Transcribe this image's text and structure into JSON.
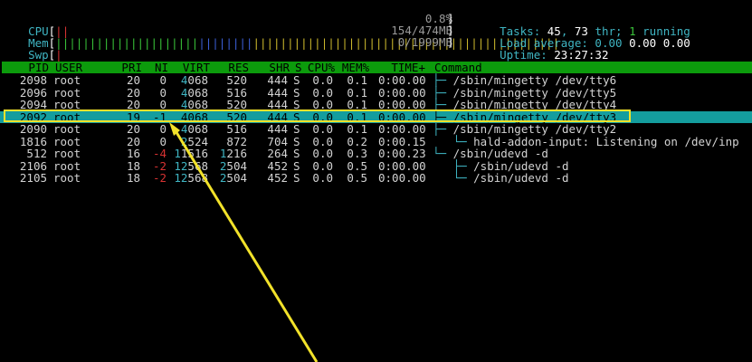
{
  "meters": {
    "cpu": {
      "label": "CPU",
      "bar": "||",
      "value": "0.8%"
    },
    "mem": {
      "label": "Mem",
      "bar_green": "|||||||||||||||||||||",
      "bar_blue": "||||||||",
      "bar_yellow": "|||||||||||||||||||||||||||||||||||||||||||||",
      "value": "154/474MB"
    },
    "swp": {
      "label": "Swp",
      "bar": "|",
      "value": "0/1999MB"
    }
  },
  "stats": {
    "tasks_label": "Tasks: ",
    "tasks": "45",
    "threads": "73",
    "thr_label": " thr; ",
    "running": "1",
    "running_label": " running",
    "load_label": "Load average: ",
    "load1": "0.00",
    "load5": "0.00",
    "load15": "0.00",
    "uptime_label": "Uptime: ",
    "uptime": "23:27:32"
  },
  "columns": [
    "PID",
    "USER",
    "PRI",
    "NI",
    "VIRT",
    "RES",
    "SHR",
    "S",
    "CPU%",
    "MEM%",
    "TIME+",
    "Command"
  ],
  "processes": [
    {
      "pid": "2098",
      "user": "root",
      "pri": "20",
      "ni": "0",
      "virt_a": "4",
      "virt_b": "068",
      "res": "520",
      "shr": "444",
      "s": "S",
      "cpu": "0.0",
      "mem": "0.1",
      "time": "0:00.00",
      "tree": "├─ ",
      "cmd": "/sbin/mingetty /dev/tty6",
      "selected": false
    },
    {
      "pid": "2096",
      "user": "root",
      "pri": "20",
      "ni": "0",
      "virt_a": "4",
      "virt_b": "068",
      "res": "516",
      "shr": "444",
      "s": "S",
      "cpu": "0.0",
      "mem": "0.1",
      "time": "0:00.00",
      "tree": "├─ ",
      "cmd": "/sbin/mingetty /dev/tty5",
      "selected": false
    },
    {
      "pid": "2094",
      "user": "root",
      "pri": "20",
      "ni": "0",
      "virt_a": "4",
      "virt_b": "068",
      "res": "520",
      "shr": "444",
      "s": "S",
      "cpu": "0.0",
      "mem": "0.1",
      "time": "0:00.00",
      "tree": "├─ ",
      "cmd": "/sbin/mingetty /dev/tty4",
      "selected": false
    },
    {
      "pid": "2092",
      "user": "root",
      "pri": "19",
      "ni": "-1",
      "virt_a": "4",
      "virt_b": "068",
      "res": "520",
      "shr": "444",
      "s": "S",
      "cpu": "0.0",
      "mem": "0.1",
      "time": "0:00.00",
      "tree": "├─ ",
      "cmd": "/sbin/mingetty /dev/tty3",
      "selected": true
    },
    {
      "pid": "2090",
      "user": "root",
      "pri": "20",
      "ni": "0",
      "virt_a": "4",
      "virt_b": "068",
      "res": "516",
      "shr": "444",
      "s": "S",
      "cpu": "0.0",
      "mem": "0.1",
      "time": "0:00.00",
      "tree": "├─ ",
      "cmd": "/sbin/mingetty /dev/tty2",
      "selected": false
    },
    {
      "pid": "1816",
      "user": "root",
      "pri": "20",
      "ni": "0",
      "virt_a": "2",
      "virt_b": "524",
      "res": "872",
      "shr": "704",
      "s": "S",
      "cpu": "0.0",
      "mem": "0.2",
      "time": "0:00.15",
      "tree": "   └─ ",
      "cmd": "hald-addon-input: Listening on /dev/inp",
      "selected": false
    },
    {
      "pid": "512",
      "user": "root",
      "pri": "16",
      "ni": "-4",
      "virt_a": "1",
      "virt_b": "1516",
      "res_a": "1",
      "res": "216",
      "shr": "264",
      "s": "S",
      "cpu": "0.0",
      "mem": "0.3",
      "time": "0:00.23",
      "tree": "└─ ",
      "cmd": "/sbin/udevd -d",
      "selected": false
    },
    {
      "pid": "2106",
      "user": "root",
      "pri": "18",
      "ni": "-2",
      "virt_a": "12",
      "virt_b": "568",
      "res_a": "2",
      "res": "504",
      "shr": "452",
      "s": "S",
      "cpu": "0.0",
      "mem": "0.5",
      "time": "0:00.00",
      "tree": "   ├─ ",
      "cmd": "/sbin/udevd -d",
      "selected": false
    },
    {
      "pid": "2105",
      "user": "root",
      "pri": "18",
      "ni": "-2",
      "virt_a": "12",
      "virt_b": "568",
      "res_a": "2",
      "res": "504",
      "shr": "452",
      "s": "S",
      "cpu": "0.0",
      "mem": "0.5",
      "time": "0:00.00",
      "tree": "   └─ ",
      "cmd": "/sbin/udevd -d",
      "selected": false
    }
  ],
  "colors": {
    "header_bg": "#0c9b0c",
    "selected_bg": "#149d9e",
    "annotation": "#f2e22a",
    "cyan": "#3fb5c3",
    "red": "#d73232"
  }
}
